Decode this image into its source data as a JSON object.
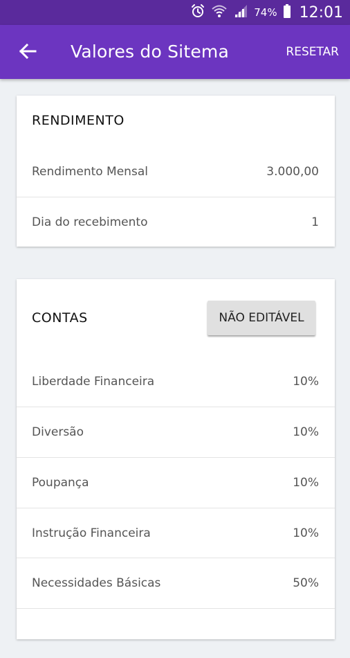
{
  "status_bar": {
    "battery": "74%",
    "time": "12:01",
    "icons": [
      "alarm-icon",
      "wifi-icon",
      "signal-icon",
      "battery-icon"
    ]
  },
  "app_bar": {
    "title": "Valores do Sitema",
    "reset_label": "RESETAR",
    "back_icon": "arrow-left-icon"
  },
  "income": {
    "title": "RENDIMENTO",
    "rows": [
      {
        "label": "Rendimento Mensal",
        "value": "3.000,00"
      },
      {
        "label": "Dia do recebimento",
        "value": "1"
      }
    ]
  },
  "accounts": {
    "title": "CONTAS",
    "button_label": "NÃO EDITÁVEL",
    "rows": [
      {
        "label": "Liberdade Financeira",
        "value": "10%"
      },
      {
        "label": "Diversão",
        "value": "10%"
      },
      {
        "label": "Poupança",
        "value": "10%"
      },
      {
        "label": "Instrução Financeira",
        "value": "10%"
      },
      {
        "label": "Necessidades Básicas",
        "value": "50%"
      }
    ]
  },
  "colors": {
    "status_bar": "#5a2a9c",
    "app_bar": "#6c35c0",
    "background": "#eef1f4"
  }
}
